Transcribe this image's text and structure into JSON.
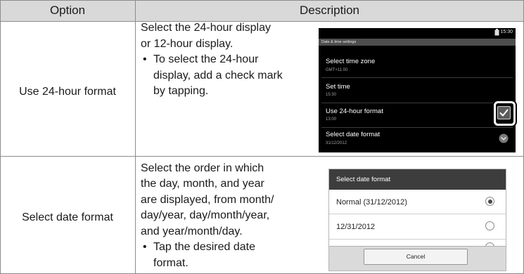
{
  "table": {
    "headers": {
      "option": "Option",
      "description": "Description"
    },
    "rows": [
      {
        "option": "Use 24-hour format",
        "description": {
          "lines": [
            "Select the 24-hour display",
            "or 12-hour display."
          ],
          "bullet": "•",
          "bullet_lines": [
            "To select the 24-hour",
            "display, add a check mark",
            "by tapping."
          ]
        }
      },
      {
        "option": "Select date format",
        "description": {
          "lines": [
            "Select the order in which",
            "the day, month, and year",
            "are displayed, from month/",
            "day/year, day/month/year,",
            "and year/month/day."
          ],
          "bullet": "•",
          "bullet_lines": [
            "Tap the desired date",
            "format."
          ]
        }
      }
    ]
  },
  "time_settings_screen": {
    "status_time": "15:30",
    "title": "Date & time settings",
    "items": [
      {
        "label": "Select time zone",
        "value": "GMT+11:00"
      },
      {
        "label": "Set time",
        "value": "15:30"
      },
      {
        "label": "Use 24-hour format",
        "value": "13:00",
        "checked": true,
        "highlighted": true
      },
      {
        "label": "Select date format",
        "value": "31/12/2012"
      }
    ],
    "icons": {
      "status": "battery-icon",
      "checkbox": "check-icon",
      "dropdown": "chevron-down-icon"
    }
  },
  "date_format_dialog": {
    "title": "Select date format",
    "options": [
      {
        "label": "Normal (31/12/2012)",
        "selected": true
      },
      {
        "label": "12/31/2012",
        "selected": false
      }
    ],
    "cancel_label": "Cancel"
  },
  "colors": {
    "header_background": "#d9d9d9",
    "border": "#8c8c8c",
    "text": "#1a1a1a",
    "screen_background": "#000000",
    "dialog_title_background": "#3d3d3d",
    "dialog_background": "#ffffff"
  }
}
